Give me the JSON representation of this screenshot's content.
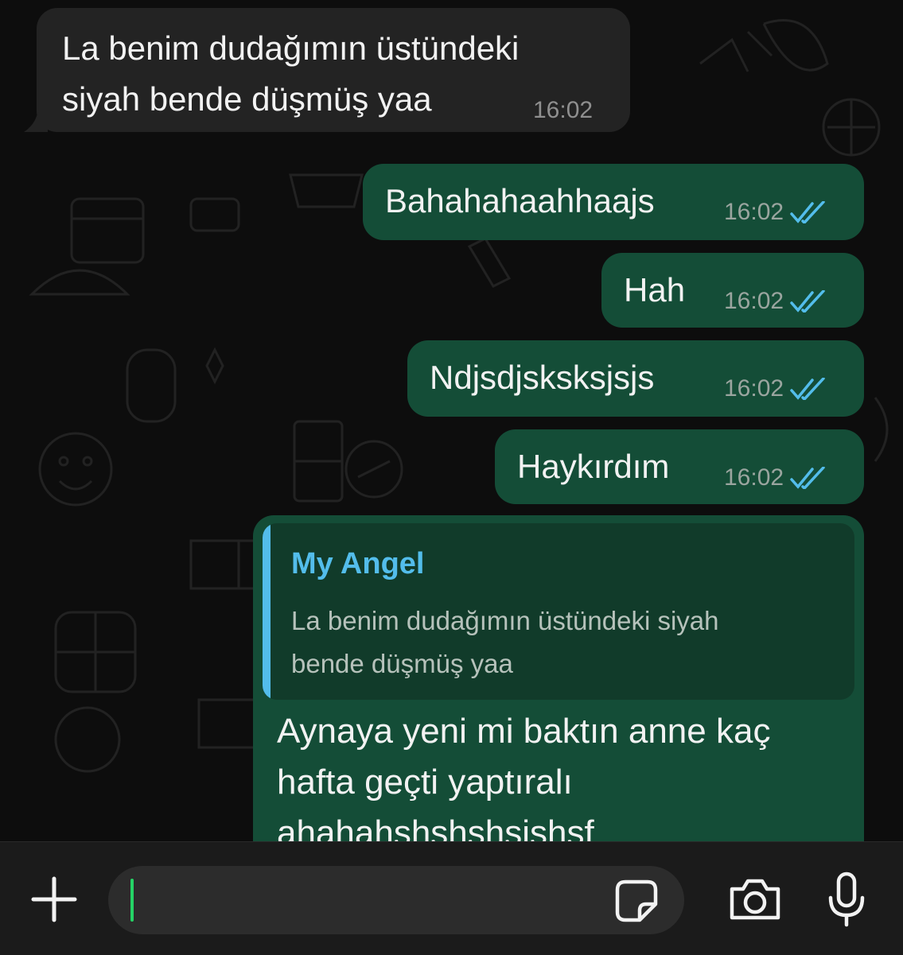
{
  "messages": {
    "incoming_1": {
      "text_line1": "La benim dudağımın üstündeki",
      "text_line2": "siyah bende düşmüş yaa",
      "time": "16:02"
    },
    "outgoing_1": {
      "text": "Bahahahaahhaajs",
      "time": "16:02"
    },
    "outgoing_2": {
      "text": "Hah",
      "time": "16:02"
    },
    "outgoing_3": {
      "text": "Ndjsdjsksksjsjs",
      "time": "16:02"
    },
    "outgoing_4": {
      "text": "Haykırdım",
      "time": "16:02"
    },
    "reply": {
      "quoted_name": "My Angel",
      "quoted_line1": "La benim dudağımın üstündeki siyah",
      "quoted_line2": "bende düşmüş yaa",
      "text_line1": "Aynaya yeni mi baktın anne  kaç",
      "text_line2": "hafta geçti yaptıralı",
      "text_line3": "ahahahshshshsjshsf"
    }
  },
  "composer": {
    "value": ""
  },
  "icons": {
    "attach": "plus-icon",
    "sticker": "sticker-icon",
    "camera": "camera-icon",
    "mic": "microphone-icon",
    "read_receipt": "double-check-icon"
  },
  "colors": {
    "incoming_bubble": "#232323",
    "outgoing_bubble": "#144d37",
    "read_ticks": "#53bdeb",
    "quote_name": "#53bdeb"
  }
}
